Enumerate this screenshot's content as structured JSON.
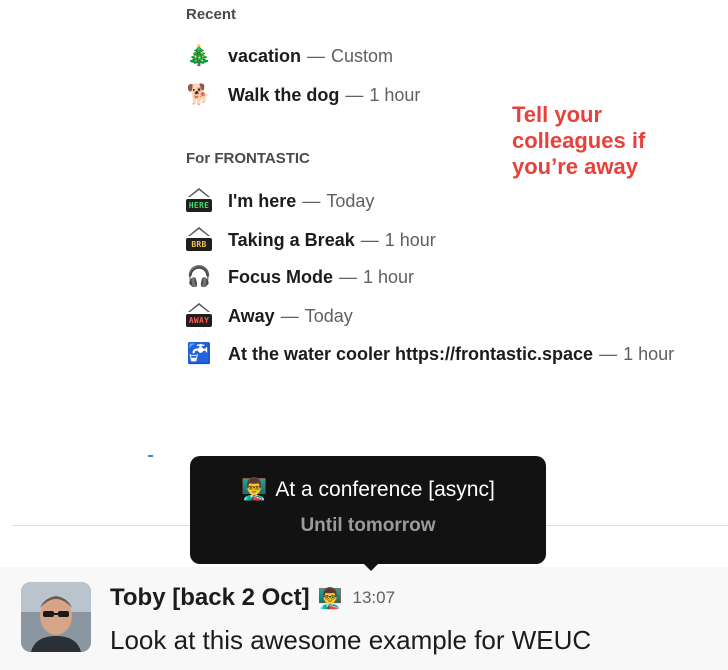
{
  "recent": {
    "heading": "Recent",
    "items": [
      {
        "emoji": "🎄",
        "emoji_name": "christmas-tree-icon",
        "name": "vacation",
        "dash": "—",
        "duration": "Custom"
      },
      {
        "emoji": "🐕",
        "emoji_name": "dog-icon",
        "name": "Walk the dog",
        "dash": "—",
        "duration": "1 hour"
      }
    ]
  },
  "workspace": {
    "heading": "For FRONTASTIC",
    "items": [
      {
        "sign": "HERE",
        "sign_bg": "#1f1f1f",
        "sign_fg": "#3ddc6a",
        "emoji_name": "here-sign-icon",
        "name": "I'm here",
        "dash": "—",
        "duration": "Today"
      },
      {
        "sign": "BRB",
        "sign_bg": "#1f1f1f",
        "sign_fg": "#f2c14e",
        "emoji_name": "brb-sign-icon",
        "name": "Taking a Break",
        "dash": "—",
        "duration": "1 hour"
      },
      {
        "emoji": "🎧",
        "emoji_name": "headphones-icon",
        "name": "Focus Mode",
        "dash": "—",
        "duration": "1 hour"
      },
      {
        "sign": "AWAY",
        "sign_bg": "#1f1f1f",
        "sign_fg": "#ff5a4f",
        "emoji_name": "away-sign-icon",
        "name": "Away",
        "dash": "—",
        "duration": "Today"
      },
      {
        "emoji": "🚰",
        "emoji_name": "water-cooler-icon",
        "name": "At the water cooler https://frontastic.space",
        "dash": "—",
        "duration": "1 hour"
      }
    ]
  },
  "annotation": {
    "text": "Tell your colleagues if you’re away",
    "color": "#e8413b"
  },
  "tooltip": {
    "emoji": "👨‍🏫",
    "emoji_name": "teacher-icon",
    "title": "At a conference [async]",
    "subtitle": "Until tomorrow"
  },
  "message": {
    "author": "Toby [back 2 Oct]",
    "status_emoji": "👨‍🏫",
    "time": "13:07",
    "text": "Look at this awesome example for WEUC"
  }
}
